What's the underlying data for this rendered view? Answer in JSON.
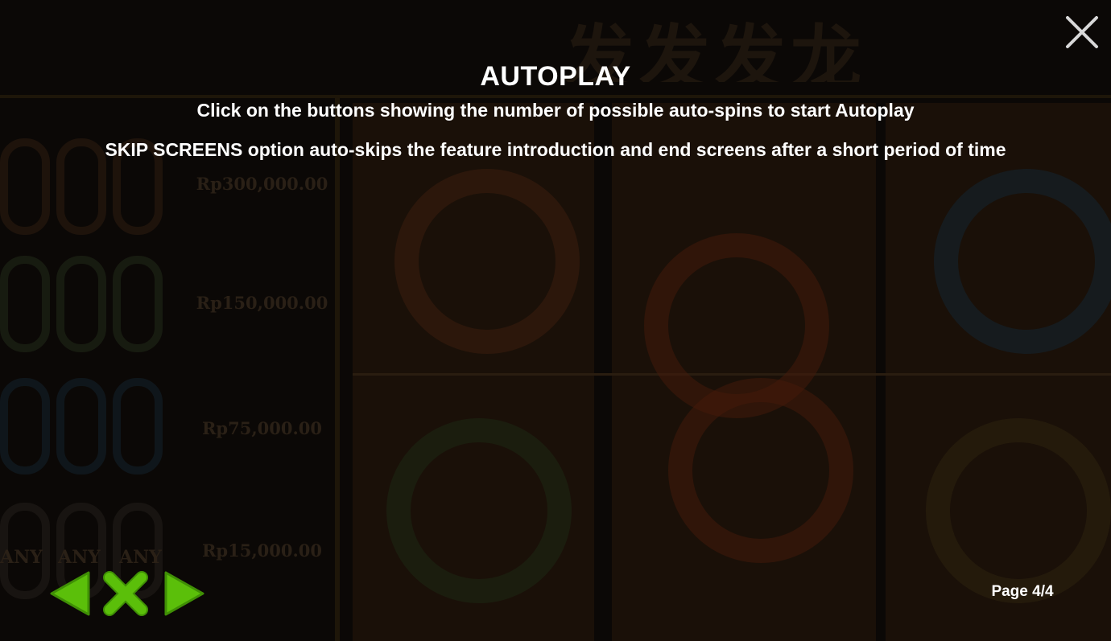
{
  "background": {
    "game_title": "发发发龙",
    "prize_values": [
      "Rp300,000.00",
      "Rp150,000.00",
      "Rp75,000.00",
      "Rp15,000.00"
    ],
    "any_labels": [
      "ANY",
      "ANY",
      "ANY"
    ]
  },
  "help": {
    "title": "AUTOPLAY",
    "lines": [
      "Click on the buttons showing the number of possible auto-spins to start Autoplay",
      "SKIP SCREENS option auto-skips the feature introduction and end screens after a short period of time"
    ],
    "page_indicator": "Page 4/4"
  },
  "controls": {
    "close_icon": "close-icon",
    "prev_icon": "arrow-left-icon",
    "exit_icon": "x-icon",
    "next_icon": "arrow-right-icon"
  },
  "colors": {
    "nav_green": "#5bbf0a",
    "nav_green_dark": "#3f8f05",
    "text": "#ffffff",
    "close": "#d8d8d8"
  }
}
